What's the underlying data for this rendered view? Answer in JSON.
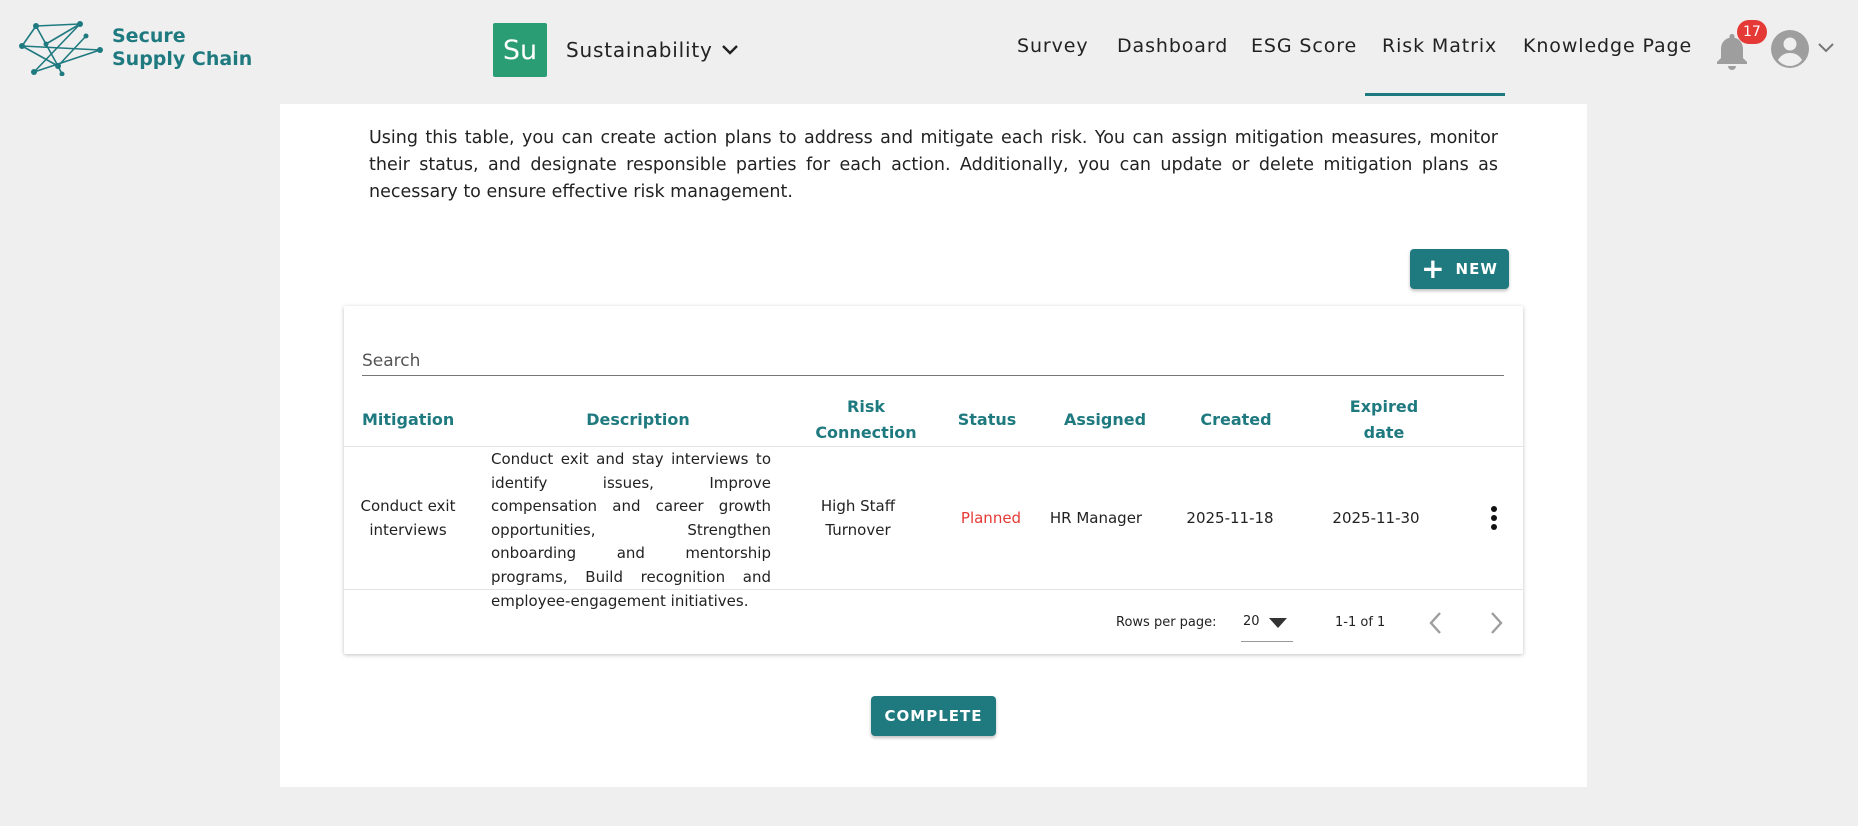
{
  "header": {
    "brand_line1": "Secure",
    "brand_line2": "Supply Chain",
    "org_badge": "Su",
    "org_name": "Sustainability",
    "nav": [
      "Survey",
      "Dashboard",
      "ESG Score",
      "Risk Matrix",
      "Knowledge Page"
    ],
    "active_nav": "Risk Matrix",
    "notification_count": "17",
    "accent_color": "#1f7a80",
    "badge_color": "#2a9d74"
  },
  "main": {
    "intro": "Using this table, you can create action plans to address and mitigate each risk. You can assign mitigation measures, monitor their status, and designate responsible parties for each action. Additionally, you can update or delete mitigation plans as necessary to ensure effective risk management.",
    "new_label": "NEW",
    "search_placeholder": "Search",
    "columns": {
      "mitigation": "Mitigation",
      "description": "Description",
      "risk_line1": "Risk",
      "risk_line2": "Connection",
      "status": "Status",
      "assigned": "Assigned",
      "created": "Created",
      "expired_line1": "Expired",
      "expired_line2": "date"
    },
    "rows": [
      {
        "mitigation": "Conduct exit interviews",
        "description": "Conduct exit and stay interviews to identify issues, Improve compensation and career growth opportunities, Strengthen onboarding and mentorship programs, Build recognition and employee-engagement initiatives.",
        "risk_connection": "High Staff Turnover",
        "status": "Planned",
        "assigned": "HR Manager",
        "created": "2025-11-18",
        "expired": "2025-11-30"
      }
    ],
    "pagination": {
      "rows_per_page_label": "Rows per page:",
      "rows_per_page": "20",
      "range": "1-1 of 1"
    },
    "complete_label": "COMPLETE"
  }
}
